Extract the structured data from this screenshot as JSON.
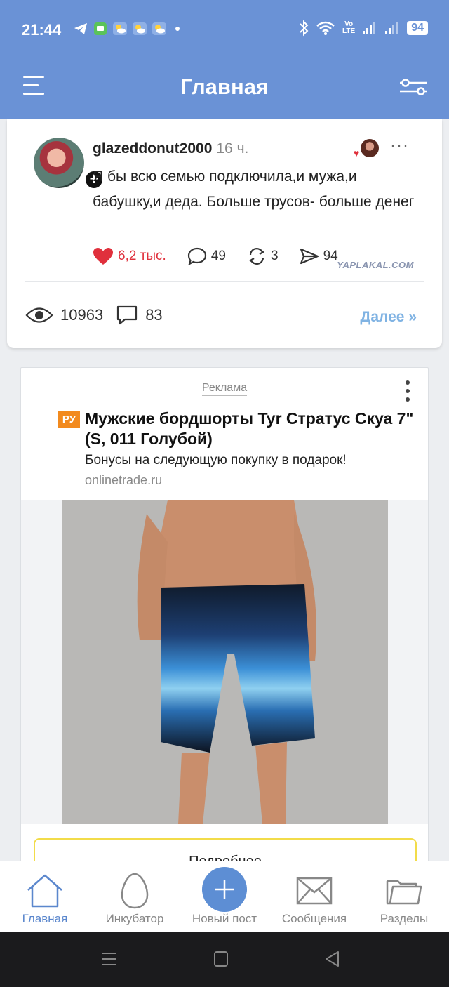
{
  "status_bar": {
    "time": "21:44",
    "volte": "Vo\nLTE",
    "battery": "94"
  },
  "header": {
    "title": "Главная"
  },
  "post": {
    "username": "glazeddonut2000",
    "time_ago": "16 ч.",
    "text": "Я бы всю семью подключила,и мужа,и бабушку,и деда. Больше трусов- больше денег",
    "likes": "6,2 тыс.",
    "comments": "49",
    "reposts": "3",
    "shares": "94",
    "watermark": "YAPLAKAL.COM",
    "views": "10963",
    "comment_count": "83",
    "more_link": "Далее »"
  },
  "ad": {
    "label": "Реклама",
    "badge": "РУ",
    "title": "Мужские бордшорты Tyr Стратус Скуа 7\" (S, 011 Голубой)",
    "subtitle": "Бонусы на следующую покупку в подарок!",
    "domain": "onlinetrade.ru",
    "button_label": "Подробнее"
  },
  "bottom_nav": {
    "items": [
      {
        "label": "Главная",
        "icon": "home-icon",
        "active": true
      },
      {
        "label": "Инкубатор",
        "icon": "egg-icon",
        "active": false
      },
      {
        "label": "Новый пост",
        "icon": "plus-icon",
        "active": false
      },
      {
        "label": "Сообщения",
        "icon": "envelope-icon",
        "active": false
      },
      {
        "label": "Разделы",
        "icon": "folder-icon",
        "active": false
      }
    ]
  },
  "colors": {
    "header_bg": "#6a92d6",
    "accent": "#5d8ed4",
    "like": "#e0303c",
    "more_link": "#80b3e3",
    "ad_badge": "#f28a1e",
    "ad_button_border": "#f2dc4a"
  }
}
